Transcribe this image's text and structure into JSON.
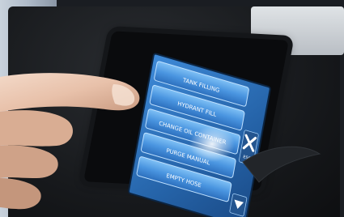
{
  "menu": {
    "items": [
      {
        "label": "TANK FILLING"
      },
      {
        "label": "HYDRANT FILL"
      },
      {
        "label": "CHANGE OIL CONTAINER"
      },
      {
        "label": "PURGE MANUAL"
      },
      {
        "label": "EMPTY HOSE"
      }
    ],
    "esc_label": "ESC"
  },
  "colors": {
    "screen_blue": "#2f78c8",
    "button_blue": "#4a9ae6",
    "device_black": "#15171a"
  },
  "icons": {
    "close": "x-mark",
    "scroll_down": "triangle-down"
  }
}
